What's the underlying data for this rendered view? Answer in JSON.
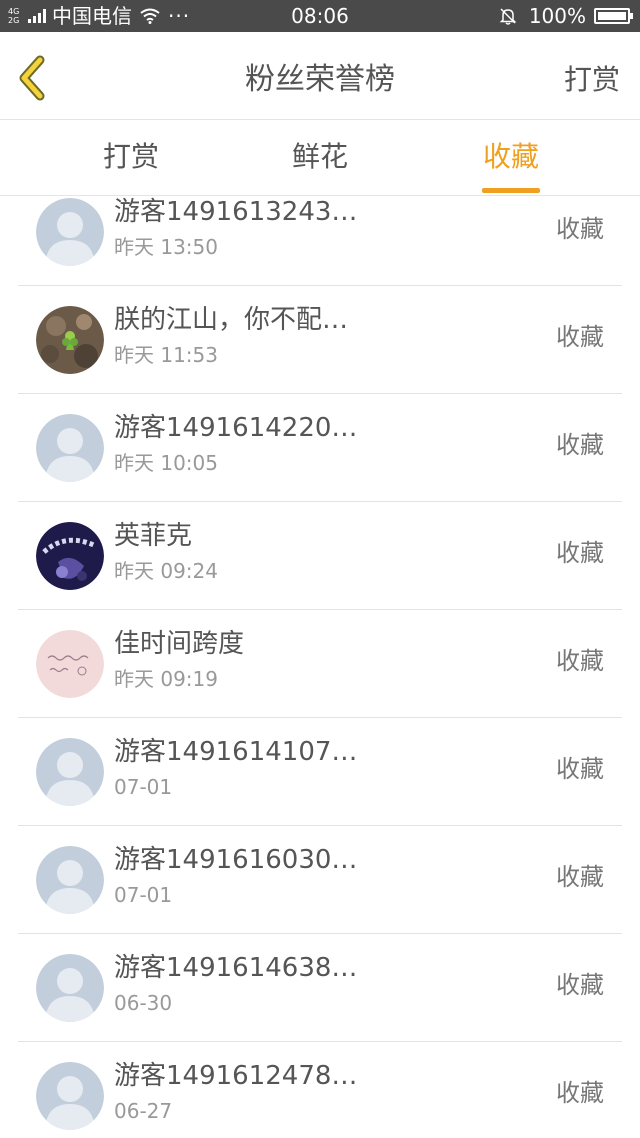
{
  "status_bar": {
    "network": "4G¹ 2G",
    "carrier": "中国电信",
    "more": "···",
    "time": "08:06",
    "battery": "100%"
  },
  "nav": {
    "title": "粉丝荣誉榜",
    "action": "打赏"
  },
  "tabs": [
    {
      "label": "打赏"
    },
    {
      "label": "鲜花"
    },
    {
      "label": "收藏"
    }
  ],
  "active_tab": "收藏",
  "accent_color": "#f0a020",
  "items": [
    {
      "name": "游客1491613243…",
      "time": "昨天 13:50",
      "action": "收藏",
      "avatar": "default-avatar"
    },
    {
      "name": "朕的江山，你不配…",
      "time": "昨天 11:53",
      "action": "收藏",
      "avatar": "plant-photo"
    },
    {
      "name": "游客1491614220…",
      "time": "昨天 10:05",
      "action": "收藏",
      "avatar": "default-avatar"
    },
    {
      "name": "英菲克",
      "time": "昨天 09:24",
      "action": "收藏",
      "avatar": "anime-photo"
    },
    {
      "name": "佳时间跨度",
      "time": "昨天 09:19",
      "action": "收藏",
      "avatar": "handwriting-photo"
    },
    {
      "name": "游客1491614107…",
      "time": "07-01",
      "action": "收藏",
      "avatar": "default-avatar"
    },
    {
      "name": "游客1491616030…",
      "time": "07-01",
      "action": "收藏",
      "avatar": "default-avatar"
    },
    {
      "name": "游客1491614638…",
      "time": "06-30",
      "action": "收藏",
      "avatar": "default-avatar"
    },
    {
      "name": "游客1491612478…",
      "time": "06-27",
      "action": "收藏",
      "avatar": "default-avatar"
    }
  ]
}
